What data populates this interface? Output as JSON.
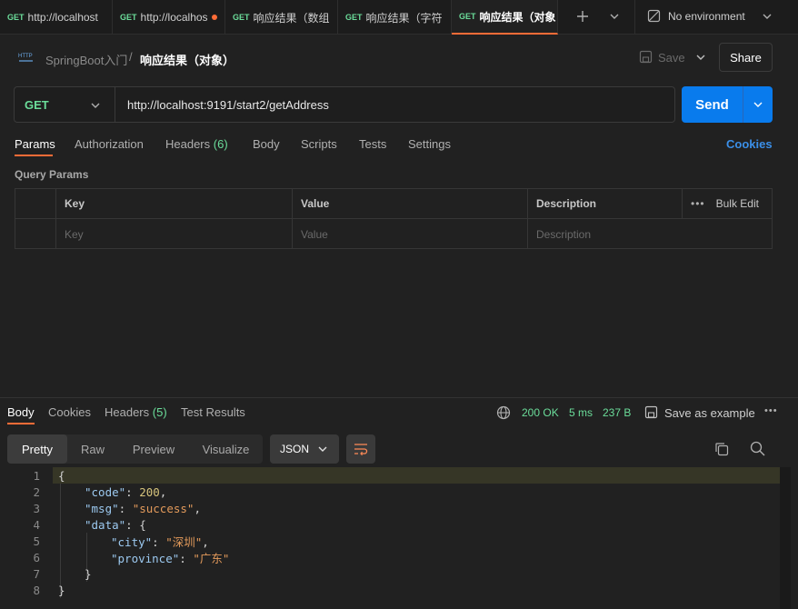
{
  "tabs": [
    {
      "method": "GET",
      "label": "http://localhost",
      "active": false,
      "unsaved": false
    },
    {
      "method": "GET",
      "label": "http://localhos",
      "active": false,
      "unsaved": true
    },
    {
      "method": "GET",
      "label": "响应结果（数组",
      "active": false,
      "unsaved": false
    },
    {
      "method": "GET",
      "label": "响应结果（字符",
      "active": false,
      "unsaved": false
    },
    {
      "method": "GET",
      "label": "响应结果（对象",
      "active": true,
      "unsaved": false
    }
  ],
  "environment": "No environment",
  "breadcrumb": {
    "collection": "SpringBoot入门",
    "separator": "/",
    "request": "响应结果（对象）"
  },
  "header_actions": {
    "save": "Save",
    "share": "Share"
  },
  "request": {
    "method": "GET",
    "url": "http://localhost:9191/start2/getAddress",
    "send": "Send"
  },
  "request_tabs": {
    "params": "Params",
    "authorization": "Authorization",
    "headers": "Headers",
    "headers_count": "(6)",
    "body": "Body",
    "scripts": "Scripts",
    "tests": "Tests",
    "settings": "Settings",
    "cookies": "Cookies"
  },
  "query_params": {
    "title": "Query Params",
    "columns": {
      "key": "Key",
      "value": "Value",
      "description": "Description",
      "bulk_edit": "Bulk Edit"
    },
    "placeholders": {
      "key": "Key",
      "value": "Value",
      "description": "Description"
    }
  },
  "response_tabs": {
    "body": "Body",
    "cookies": "Cookies",
    "headers": "Headers",
    "headers_count": "(5)",
    "test_results": "Test Results"
  },
  "response_status": {
    "status": "200 OK",
    "time": "5 ms",
    "size": "237 B",
    "save_example": "Save as example"
  },
  "view_modes": {
    "pretty": "Pretty",
    "raw": "Raw",
    "preview": "Preview",
    "visualize": "Visualize",
    "format": "JSON"
  },
  "response_body": {
    "line_numbers": [
      "1",
      "2",
      "3",
      "4",
      "5",
      "6",
      "7",
      "8"
    ],
    "open_brace": "{",
    "close_brace": "}",
    "code_key": "\"code\"",
    "code_value": "200",
    "msg_key": "\"msg\"",
    "msg_value": "\"success\"",
    "data_key": "\"data\"",
    "city_key": "\"city\"",
    "city_value": "\"深圳\"",
    "province_key": "\"province\"",
    "province_value": "\"广东\"",
    "colon": ": ",
    "comma": ","
  },
  "colors": {
    "accent": "#097bed",
    "method_get": "#6bdd9a",
    "unsaved_dot": "#ff6c37",
    "status_ok": "#6bdd9a"
  }
}
